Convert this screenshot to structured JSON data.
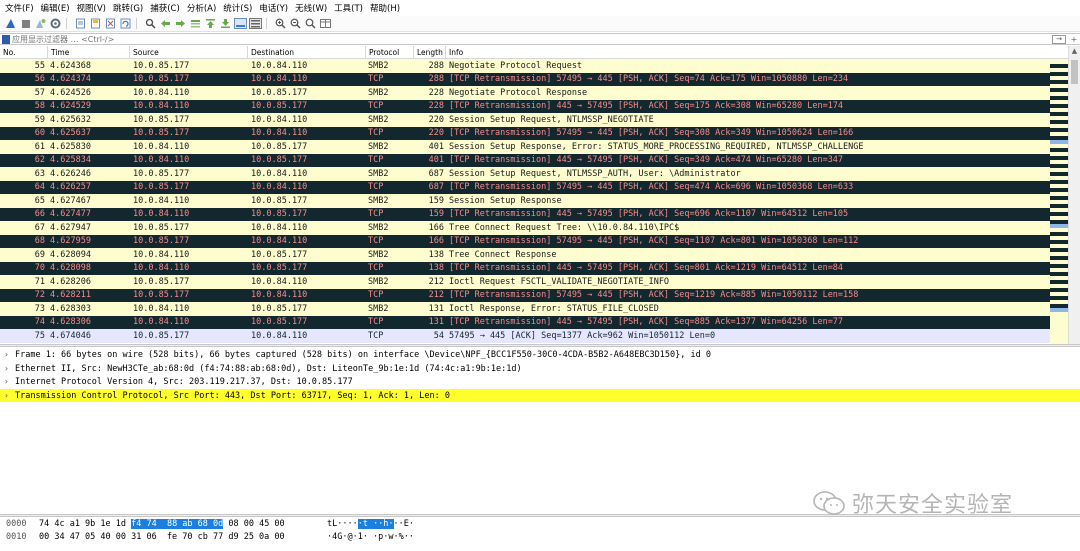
{
  "menu": [
    "文件(F)",
    "编辑(E)",
    "视图(V)",
    "跳转(G)",
    "捕获(C)",
    "分析(A)",
    "统计(S)",
    "电话(Y)",
    "无线(W)",
    "工具(T)",
    "帮助(H)"
  ],
  "toolbar": {
    "icons": [
      "shark-fin-start-icon",
      "stop-icon",
      "restart-icon",
      "options-gear-icon",
      "open-file-icon",
      "save-file-icon",
      "close-file-icon",
      "reload-icon",
      "find-icon",
      "back-arrow-icon",
      "forward-arrow-icon",
      "go-to-packet-icon",
      "go-first-icon",
      "go-last-icon",
      "autoscroll-icon",
      "colorize-icon",
      "zoom-in-icon",
      "zoom-out-icon",
      "zoom-normal-icon",
      "resize-columns-icon"
    ]
  },
  "filter": {
    "placeholder": "应用显示过滤器 … <Ctrl-/>",
    "arrow": "→",
    "add": "+"
  },
  "columns": {
    "no": "No.",
    "time": "Time",
    "source": "Source",
    "destination": "Destination",
    "protocol": "Protocol",
    "length": "Length",
    "info": "Info"
  },
  "colors": {
    "smb_bg": "#fdfdcf",
    "retransmission_bg": "#12272e",
    "retransmission_fg": "#f78c8c",
    "tcp_bg": "#e7e6ff",
    "selected_detail": "#ffff2e",
    "byte_highlight": "#1b7fe0"
  },
  "packets": [
    {
      "no": "55",
      "time": "4.624368",
      "src": "10.0.85.177",
      "dst": "10.0.84.110",
      "proto": "SMB2",
      "len": "288",
      "info": "Negotiate Protocol Request",
      "style": "smb"
    },
    {
      "no": "56",
      "time": "4.624374",
      "src": "10.0.85.177",
      "dst": "10.0.84.110",
      "proto": "TCP",
      "len": "288",
      "info": "[TCP Retransmission] 57495 → 445 [PSH, ACK] Seq=74 Ack=175 Win=1050880 Len=234",
      "style": "retx"
    },
    {
      "no": "57",
      "time": "4.624526",
      "src": "10.0.84.110",
      "dst": "10.0.85.177",
      "proto": "SMB2",
      "len": "228",
      "info": "Negotiate Protocol Response",
      "style": "smb"
    },
    {
      "no": "58",
      "time": "4.624529",
      "src": "10.0.84.110",
      "dst": "10.0.85.177",
      "proto": "TCP",
      "len": "228",
      "info": "[TCP Retransmission] 445 → 57495 [PSH, ACK] Seq=175 Ack=308 Win=65280 Len=174",
      "style": "retx"
    },
    {
      "no": "59",
      "time": "4.625632",
      "src": "10.0.85.177",
      "dst": "10.0.84.110",
      "proto": "SMB2",
      "len": "220",
      "info": "Session Setup Request, NTLMSSP_NEGOTIATE",
      "style": "smb"
    },
    {
      "no": "60",
      "time": "4.625637",
      "src": "10.0.85.177",
      "dst": "10.0.84.110",
      "proto": "TCP",
      "len": "220",
      "info": "[TCP Retransmission] 57495 → 445 [PSH, ACK] Seq=308 Ack=349 Win=1050624 Len=166",
      "style": "retx"
    },
    {
      "no": "61",
      "time": "4.625830",
      "src": "10.0.84.110",
      "dst": "10.0.85.177",
      "proto": "SMB2",
      "len": "401",
      "info": "Session Setup Response, Error: STATUS_MORE_PROCESSING_REQUIRED, NTLMSSP_CHALLENGE",
      "style": "smb"
    },
    {
      "no": "62",
      "time": "4.625834",
      "src": "10.0.84.110",
      "dst": "10.0.85.177",
      "proto": "TCP",
      "len": "401",
      "info": "[TCP Retransmission] 445 → 57495 [PSH, ACK] Seq=349 Ack=474 Win=65280 Len=347",
      "style": "retx"
    },
    {
      "no": "63",
      "time": "4.626246",
      "src": "10.0.85.177",
      "dst": "10.0.84.110",
      "proto": "SMB2",
      "len": "687",
      "info": "Session Setup Request, NTLMSSP_AUTH, User: \\Administrator",
      "style": "smb"
    },
    {
      "no": "64",
      "time": "4.626257",
      "src": "10.0.85.177",
      "dst": "10.0.84.110",
      "proto": "TCP",
      "len": "687",
      "info": "[TCP Retransmission] 57495 → 445 [PSH, ACK] Seq=474 Ack=696 Win=1050368 Len=633",
      "style": "retx"
    },
    {
      "no": "65",
      "time": "4.627467",
      "src": "10.0.84.110",
      "dst": "10.0.85.177",
      "proto": "SMB2",
      "len": "159",
      "info": "Session Setup Response",
      "style": "smb"
    },
    {
      "no": "66",
      "time": "4.627477",
      "src": "10.0.84.110",
      "dst": "10.0.85.177",
      "proto": "TCP",
      "len": "159",
      "info": "[TCP Retransmission] 445 → 57495 [PSH, ACK] Seq=696 Ack=1107 Win=64512 Len=105",
      "style": "retx"
    },
    {
      "no": "67",
      "time": "4.627947",
      "src": "10.0.85.177",
      "dst": "10.0.84.110",
      "proto": "SMB2",
      "len": "166",
      "info": "Tree Connect Request Tree: \\\\10.0.84.110\\IPC$",
      "style": "smb"
    },
    {
      "no": "68",
      "time": "4.627959",
      "src": "10.0.85.177",
      "dst": "10.0.84.110",
      "proto": "TCP",
      "len": "166",
      "info": "[TCP Retransmission] 57495 → 445 [PSH, ACK] Seq=1107 Ack=801 Win=1050368 Len=112",
      "style": "retx"
    },
    {
      "no": "69",
      "time": "4.628094",
      "src": "10.0.84.110",
      "dst": "10.0.85.177",
      "proto": "SMB2",
      "len": "138",
      "info": "Tree Connect Response",
      "style": "smb"
    },
    {
      "no": "70",
      "time": "4.628098",
      "src": "10.0.84.110",
      "dst": "10.0.85.177",
      "proto": "TCP",
      "len": "138",
      "info": "[TCP Retransmission] 445 → 57495 [PSH, ACK] Seq=801 Ack=1219 Win=64512 Len=84",
      "style": "retx"
    },
    {
      "no": "71",
      "time": "4.628206",
      "src": "10.0.85.177",
      "dst": "10.0.84.110",
      "proto": "SMB2",
      "len": "212",
      "info": "Ioctl Request FSCTL_VALIDATE_NEGOTIATE_INFO",
      "style": "smb"
    },
    {
      "no": "72",
      "time": "4.628211",
      "src": "10.0.85.177",
      "dst": "10.0.84.110",
      "proto": "TCP",
      "len": "212",
      "info": "[TCP Retransmission] 57495 → 445 [PSH, ACK] Seq=1219 Ack=885 Win=1050112 Len=158",
      "style": "retx"
    },
    {
      "no": "73",
      "time": "4.628303",
      "src": "10.0.84.110",
      "dst": "10.0.85.177",
      "proto": "SMB2",
      "len": "131",
      "info": "Ioctl Response, Error: STATUS_FILE_CLOSED",
      "style": "smb"
    },
    {
      "no": "74",
      "time": "4.628306",
      "src": "10.0.84.110",
      "dst": "10.0.85.177",
      "proto": "TCP",
      "len": "131",
      "info": "[TCP Retransmission] 445 → 57495 [PSH, ACK] Seq=885 Ack=1377 Win=64256 Len=77",
      "style": "retx"
    },
    {
      "no": "75",
      "time": "4.674046",
      "src": "10.0.85.177",
      "dst": "10.0.84.110",
      "proto": "TCP",
      "len": "54",
      "info": "57495 → 445 [ACK] Seq=1377 Ack=962 Win=1050112 Len=0",
      "style": "tcp"
    }
  ],
  "details": [
    {
      "text": "Frame 1: 66 bytes on wire (528 bits), 66 bytes captured (528 bits) on interface \\Device\\NPF_{BCC1F550-30C0-4CDA-B5B2-A648EBC3D150}, id 0",
      "selected": false
    },
    {
      "text": "Ethernet II, Src: NewH3CTe_ab:68:0d (f4:74:88:ab:68:0d), Dst: LiteonTe_9b:1e:1d (74:4c:a1:9b:1e:1d)",
      "selected": false
    },
    {
      "text": "Internet Protocol Version 4, Src: 203.119.217.37, Dst: 10.0.85.177",
      "selected": false
    },
    {
      "text": "Transmission Control Protocol, Src Port: 443, Dst Port: 63717, Seq: 1, Ack: 1, Len: 0",
      "selected": true
    }
  ],
  "bytes": [
    {
      "offset": "0000",
      "hex_pre": "74 4c a1 9b 1e 1d ",
      "hex_hl": "f4 74  88 ab 68 0d",
      "hex_post": " 08 00 45 00",
      "ascii_pre": "tL····",
      "ascii_hl": "·t ··h·",
      "ascii_post": "··E·"
    },
    {
      "offset": "0010",
      "hex_pre": "00 34 47 05 40 00 31 06  fe 70 cb 77 d9 25 0a 00",
      "hex_hl": "",
      "hex_post": "",
      "ascii_pre": "·4G·@·1· ·p·w·%··",
      "ascii_hl": "",
      "ascii_post": ""
    }
  ],
  "watermark": {
    "text": "弥天安全实验室"
  },
  "tree_toggle": "›"
}
